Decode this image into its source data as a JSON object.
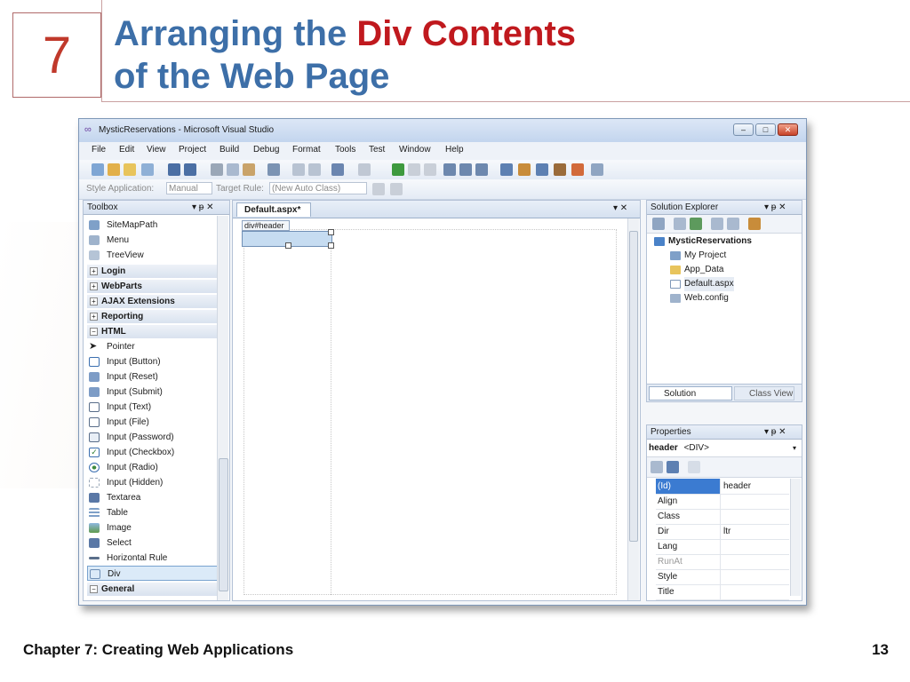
{
  "slide": {
    "chapter_number": "7",
    "title_part1": "Arranging the ",
    "title_accent": "Div Contents",
    "title_line2": "of the Web Page",
    "footer_left": "Chapter 7: Creating Web Applications",
    "footer_right": "13"
  },
  "window": {
    "title": "MysticReservations - Microsoft Visual Studio",
    "controls": {
      "minimize": "–",
      "maximize": "□",
      "close": "✕"
    },
    "menu": [
      "File",
      "Edit",
      "View",
      "Project",
      "Build",
      "Debug",
      "Format",
      "Tools",
      "Test",
      "Window",
      "Help"
    ],
    "toolbar2": {
      "style_application_label": "Style Application:",
      "style_application_value": "Manual",
      "target_rule_label": "Target Rule:",
      "target_rule_value": "(New Auto Class)"
    }
  },
  "toolbox": {
    "title": "Toolbox",
    "pin": "▾ ᵽ ✕",
    "items_top": [
      {
        "label": "SiteMapPath",
        "icon": "sitemap-icon"
      },
      {
        "label": "Menu",
        "icon": "menu-icon"
      },
      {
        "label": "TreeView",
        "icon": "treeview-icon"
      }
    ],
    "groups": [
      {
        "label": "Login",
        "state": "+"
      },
      {
        "label": "WebParts",
        "state": "+"
      },
      {
        "label": "AJAX Extensions",
        "state": "+"
      },
      {
        "label": "Reporting",
        "state": "+"
      },
      {
        "label": "HTML",
        "state": "−"
      }
    ],
    "html_items": [
      {
        "label": "Pointer",
        "icon": "pointer-icon"
      },
      {
        "label": "Input (Button)",
        "icon": "button-icon"
      },
      {
        "label": "Input (Reset)",
        "icon": "reset-icon"
      },
      {
        "label": "Input (Submit)",
        "icon": "submit-icon"
      },
      {
        "label": "Input (Text)",
        "icon": "textbox-icon"
      },
      {
        "label": "Input (File)",
        "icon": "file-input-icon"
      },
      {
        "label": "Input (Password)",
        "icon": "password-icon"
      },
      {
        "label": "Input (Checkbox)",
        "icon": "checkbox-icon"
      },
      {
        "label": "Input (Radio)",
        "icon": "radio-icon"
      },
      {
        "label": "Input (Hidden)",
        "icon": "hidden-input-icon"
      },
      {
        "label": "Textarea",
        "icon": "textarea-icon"
      },
      {
        "label": "Table",
        "icon": "table-icon"
      },
      {
        "label": "Image",
        "icon": "image-icon"
      },
      {
        "label": "Select",
        "icon": "select-icon"
      },
      {
        "label": "Horizontal Rule",
        "icon": "horizontal-rule-icon"
      },
      {
        "label": "Div",
        "icon": "div-icon",
        "selected": true
      }
    ],
    "last_group": {
      "label": "General",
      "state": "−"
    }
  },
  "editor": {
    "tab_label": "Default.aspx*",
    "tab_controls": "▾ ✕",
    "div_tag": "div#header"
  },
  "solution_explorer": {
    "title": "Solution Explorer",
    "controls": "▾ ᵽ ✕",
    "tree": [
      {
        "label": "MysticReservations",
        "bold": true
      },
      {
        "label": "My Project"
      },
      {
        "label": "App_Data"
      },
      {
        "label": "Default.aspx"
      },
      {
        "label": "Web.config"
      }
    ],
    "tabs": [
      "Solution Explorer",
      "Class View"
    ]
  },
  "properties": {
    "title": "Properties",
    "controls": "▾ ᵽ ✕",
    "selected_object": "header",
    "selected_type": "<DIV>",
    "rows": [
      {
        "name": "(Id)",
        "value": "header",
        "selected": true
      },
      {
        "name": "Align",
        "value": ""
      },
      {
        "name": "Class",
        "value": ""
      },
      {
        "name": "Dir",
        "value": "ltr"
      },
      {
        "name": "Lang",
        "value": ""
      },
      {
        "name": "RunAt",
        "value": "",
        "dim": true
      },
      {
        "name": "Style",
        "value": ""
      },
      {
        "name": "Title",
        "value": ""
      }
    ]
  },
  "colors": {
    "title": "#3d6fa8",
    "accent": "#c0191e",
    "selection": "#3b7bd1"
  }
}
